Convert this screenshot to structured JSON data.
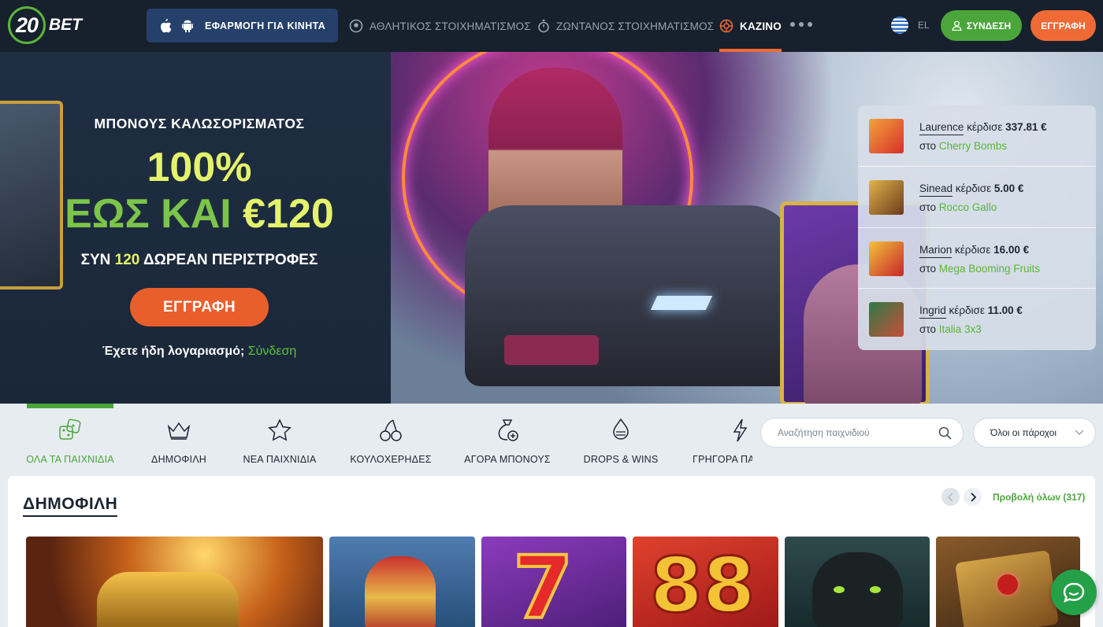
{
  "brand": {
    "logo_number": "20",
    "logo_text": "BET"
  },
  "topbar": {
    "app_button": "ΕΦΑΡΜΟΓΗ ΓΙΑ ΚΙΝΗΤΑ",
    "nav": [
      {
        "label": "ΑΘΛΗΤΙΚΟΣ ΣΤΟΙΧΗΜΑΤΙΣΜΟΣ",
        "icon": "soccer-ball-icon"
      },
      {
        "label": "ΖΩΝΤΑΝΟΣ ΣΤΟΙΧΗΜΑΤΙΣΜΟΣ",
        "icon": "stopwatch-icon"
      },
      {
        "label": "ΚΑΖΙΝΟ",
        "icon": "roulette-icon",
        "active": true
      }
    ],
    "language": "EL",
    "login": "ΣΥΝΔΕΣΗ",
    "register": "ΕΓΓΡΑΦΗ"
  },
  "hero": {
    "welcome": "ΜΠΟΝΟΥΣ ΚΑΛΩΣΟΡΙΣΜΑΤΟΣ",
    "percent": "100%",
    "upto": "ΕΩΣ ΚΑΙ",
    "amount": "€120",
    "spins_prefix": "ΣΥΝ",
    "spins_count": "120",
    "spins_suffix": "ΔΩΡΕΑΝ ΠΕΡΙΣΤΡΟΦΕΣ",
    "cta": "ΕΓΓΡΑΦΗ",
    "account_text": "Έχετε ήδη λογαριασμό;",
    "account_link": "Σύνδεση"
  },
  "winners": [
    {
      "name": "Laurence",
      "verb": "κέρδισε",
      "amount": "337.81 €",
      "in": "στο",
      "game": "Cherry Bombs"
    },
    {
      "name": "Sinead",
      "verb": "κέρδισε",
      "amount": "5.00 €",
      "in": "στο",
      "game": "Rocco Gallo"
    },
    {
      "name": "Marion",
      "verb": "κέρδισε",
      "amount": "16.00 €",
      "in": "στο",
      "game": "Mega Booming Fruits"
    },
    {
      "name": "Ingrid",
      "verb": "κέρδισε",
      "amount": "11.00 €",
      "in": "στο",
      "game": "Italia 3x3"
    }
  ],
  "categories": [
    {
      "label": "ΟΛΑ ΤΑ ΠΑΙΧΝΙΔΙΑ",
      "icon": "dice-icon",
      "active": true
    },
    {
      "label": "ΔΗΜΟΦΙΛΗ",
      "icon": "crown-icon"
    },
    {
      "label": "ΝΕΑ ΠΑΙΧΝΙΔΙΑ",
      "icon": "star-icon"
    },
    {
      "label": "ΚΟΥΛΟΧΕΡΗΔΕΣ",
      "icon": "cherries-icon"
    },
    {
      "label": "ΑΓΟΡΑ ΜΠΟΝΟΥΣ",
      "icon": "money-bag-icon"
    },
    {
      "label": "DROPS & WINS",
      "icon": "drops-wins-icon"
    },
    {
      "label": "ΓΡΗΓΟΡΑ ΠΑ",
      "icon": "lightning-icon"
    }
  ],
  "search": {
    "placeholder": "Αναζήτηση παιχνιδιού"
  },
  "provider_select": {
    "selected": "Όλοι οι πάροχοι"
  },
  "section": {
    "title": "ΔΗΜΟΦΙΛΗ",
    "view_all": "Προβολή όλων (317)"
  },
  "colors": {
    "accent_green": "#4aa63a",
    "accent_orange": "#f06a35",
    "topbar": "#17202d",
    "promo_yellow": "#e4f36a"
  }
}
